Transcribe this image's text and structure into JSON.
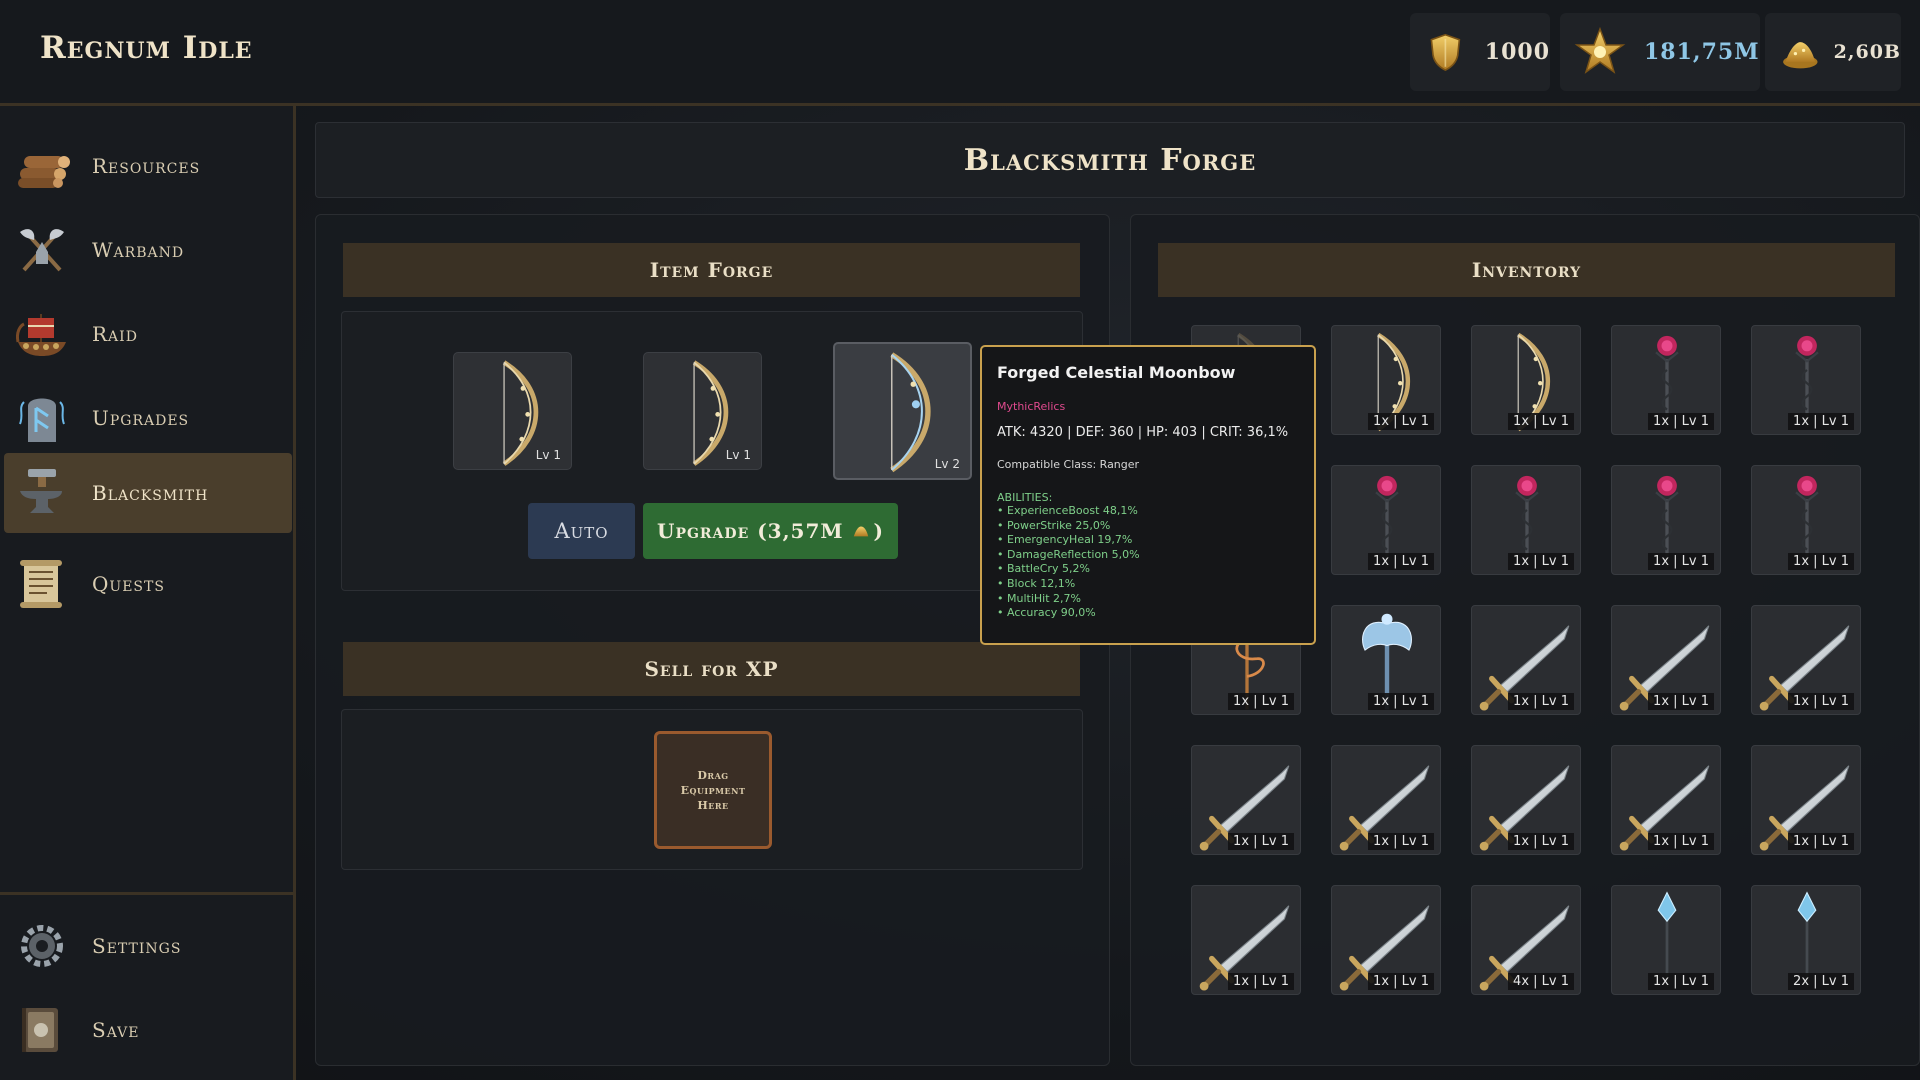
{
  "app": {
    "title": "Regnum Idle"
  },
  "currencies": [
    {
      "name": "shield",
      "value": "1000",
      "color": "#e9e2d2"
    },
    {
      "name": "star",
      "value": "181,75M",
      "color": "#8fc7e6"
    },
    {
      "name": "gold",
      "value": "2,60B",
      "color": "#e9e2d2"
    }
  ],
  "nav": {
    "items": [
      {
        "label": "Resources",
        "icon": "logs-icon"
      },
      {
        "label": "Warband",
        "icon": "crossed-axes-icon"
      },
      {
        "label": "Raid",
        "icon": "longship-icon"
      },
      {
        "label": "Upgrades",
        "icon": "rune-stone-icon"
      },
      {
        "label": "Blacksmith",
        "icon": "anvil-icon",
        "active": true
      },
      {
        "label": "Quests",
        "icon": "scroll-icon"
      }
    ],
    "bottom": [
      {
        "label": "Settings",
        "icon": "gear-icon"
      },
      {
        "label": "Save",
        "icon": "book-icon"
      }
    ]
  },
  "page": {
    "title": "Blacksmith Forge"
  },
  "forge": {
    "title": "Item Forge",
    "slots": [
      {
        "item": "bow",
        "level": "Lv 1"
      },
      {
        "item": "bow",
        "level": "Lv 1"
      },
      {
        "item": "bow",
        "level": "Lv 2",
        "selected": true
      }
    ],
    "auto_label": "Auto",
    "upgrade_label": "Upgrade (3,57M",
    "upgrade_suffix": ")"
  },
  "sell": {
    "title": "Sell for XP",
    "dropzone": "Drag Equipment Here"
  },
  "inventory": {
    "title": "Inventory",
    "items": [
      {
        "item": "bow",
        "badge": "1x | Lv 1",
        "faded": true
      },
      {
        "item": "bow",
        "badge": "1x | Lv 1"
      },
      {
        "item": "bow",
        "badge": "1x | Lv 1"
      },
      {
        "item": "rose-staff",
        "badge": "1x | Lv 1"
      },
      {
        "item": "rose-staff",
        "badge": "1x | Lv 1"
      },
      {
        "item": "rose-staff",
        "badge": "1x | Lv 1",
        "faded": true
      },
      {
        "item": "rose-staff",
        "badge": "1x | Lv 1"
      },
      {
        "item": "rose-staff",
        "badge": "1x | Lv 1"
      },
      {
        "item": "rose-staff",
        "badge": "1x | Lv 1"
      },
      {
        "item": "rose-staff",
        "badge": "1x | Lv 1"
      },
      {
        "item": "serpent-staff",
        "badge": "1x | Lv 1"
      },
      {
        "item": "frost-axe",
        "badge": "1x | Lv 1"
      },
      {
        "item": "sword",
        "badge": "1x | Lv 1"
      },
      {
        "item": "sword",
        "badge": "1x | Lv 1"
      },
      {
        "item": "sword",
        "badge": "1x | Lv 1"
      },
      {
        "item": "sword",
        "badge": "1x | Lv 1"
      },
      {
        "item": "sword",
        "badge": "1x | Lv 1"
      },
      {
        "item": "sword",
        "badge": "1x | Lv 1"
      },
      {
        "item": "sword",
        "badge": "1x | Lv 1"
      },
      {
        "item": "sword",
        "badge": "1x | Lv 1"
      },
      {
        "item": "sword",
        "badge": "1x | Lv 1"
      },
      {
        "item": "sword",
        "badge": "1x | Lv 1"
      },
      {
        "item": "sword",
        "badge": "4x | Lv 1"
      },
      {
        "item": "crystal-staff",
        "badge": "1x | Lv 1"
      },
      {
        "item": "crystal-staff",
        "badge": "2x | Lv 1"
      }
    ]
  },
  "tooltip": {
    "name": "Forged Celestial Moonbow",
    "rarity": "MythicRelics",
    "rarity_color": "#e04a8e",
    "stats": "ATK: 4320 | DEF: 360 | HP: 403 | CRIT: 36,1%",
    "class": "Compatible Class: Ranger",
    "abilities_title": "ABILITIES:",
    "abilities": [
      "ExperienceBoost 48,1%",
      "PowerStrike 25,0%",
      "EmergencyHeal 19,7%",
      "DamageReflection 5,0%",
      "BattleCry 5,2%",
      "Block 12,1%",
      "MultiHit 2,7%",
      "Accuracy 90,0%"
    ]
  },
  "colors": {
    "accent_gold": "#c9a14e",
    "nav_active": "#4a3e2c",
    "panel_title_bg": "#3a3124",
    "upgrade_green": "#2e6b33",
    "auto_blue": "#2c3a52"
  }
}
